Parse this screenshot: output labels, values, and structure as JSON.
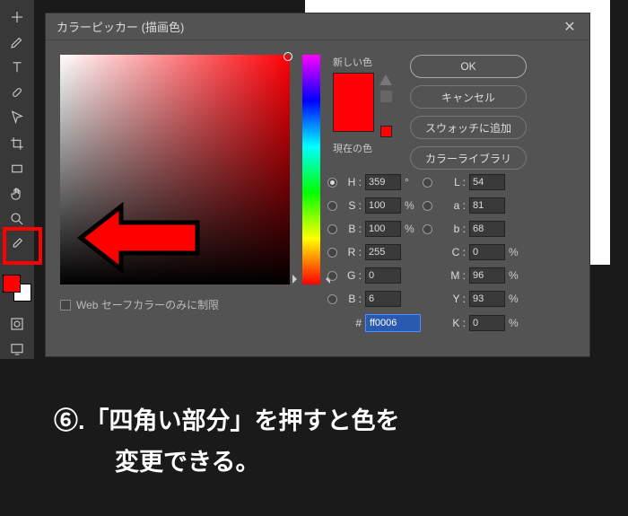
{
  "toolbar_icons": [
    "plus-icon",
    "pencil-icon",
    "text-icon",
    "bandaid-icon",
    "arrow-icon",
    "crop-icon",
    "rect-icon",
    "hand-icon",
    "zoom-icon",
    "eyedropper-icon"
  ],
  "dialog": {
    "title": "カラーピッカー (描画色)",
    "new_label": "新しい色",
    "current_label": "現在の色",
    "web_safe": "Web セーフカラーのみに制限",
    "buttons": {
      "ok": "OK",
      "cancel": "キャンセル",
      "add_swatch": "スウォッチに追加",
      "library": "カラーライブラリ"
    },
    "hsb": {
      "h": "359",
      "s": "100",
      "b": "100"
    },
    "lab": {
      "l": "54",
      "a": "81",
      "b": "68"
    },
    "rgb": {
      "r": "255",
      "g": "0",
      "b": "6"
    },
    "cmyk": {
      "c": "0",
      "m": "96",
      "y": "93",
      "k": "0"
    },
    "hex": "ff0006",
    "labels": {
      "h": "H :",
      "s": "S :",
      "bb": "B :",
      "l": "L :",
      "a": "a :",
      "lb": "b :",
      "r": "R :",
      "g": "G :",
      "rb": "B :",
      "c": "C :",
      "m": "M :",
      "y": "Y :",
      "k": "K :",
      "deg": "°",
      "pct": "%",
      "hash": "#"
    }
  },
  "caption": {
    "line1": "⑥.「四角い部分」を押すと色を",
    "line2": "変更できる。"
  }
}
